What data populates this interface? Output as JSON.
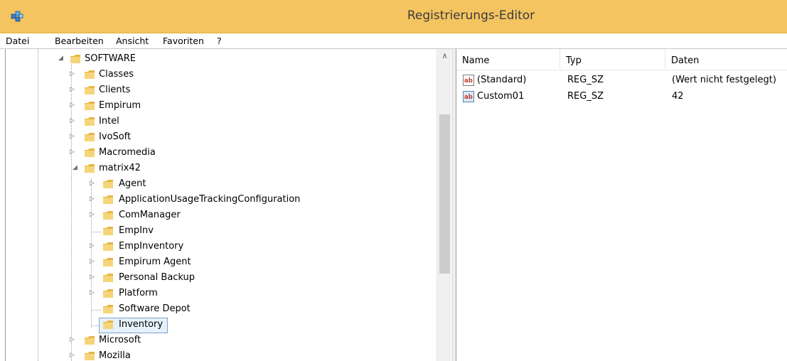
{
  "window": {
    "title": "Registrierungs-Editor",
    "icon": "registry-editor-icon"
  },
  "menu": [
    "Datei",
    "Bearbeiten",
    "Ansicht",
    "Favoriten",
    "?"
  ],
  "tree": {
    "root": {
      "label": "SOFTWARE",
      "expanded": true
    },
    "level1_before": [
      {
        "label": "Classes"
      },
      {
        "label": "Clients"
      },
      {
        "label": "Empirum"
      },
      {
        "label": "Intel"
      },
      {
        "label": "IvoSoft"
      },
      {
        "label": "Macromedia"
      }
    ],
    "expanded_node": {
      "label": "matrix42",
      "expanded": true
    },
    "children": [
      {
        "label": "Agent",
        "has_children": true
      },
      {
        "label": "ApplicationUsageTrackingConfiguration",
        "has_children": true
      },
      {
        "label": "ComManager",
        "has_children": true
      },
      {
        "label": "EmpInv",
        "has_children": false
      },
      {
        "label": "EmpInventory",
        "has_children": true
      },
      {
        "label": "Empirum Agent",
        "has_children": true
      },
      {
        "label": "Personal Backup",
        "has_children": true
      },
      {
        "label": "Platform",
        "has_children": true
      },
      {
        "label": "Software Depot",
        "has_children": false
      },
      {
        "label": "Inventory",
        "has_children": false,
        "selected": true
      }
    ],
    "level1_after": [
      {
        "label": "Microsoft"
      },
      {
        "label": "Mozilla"
      }
    ]
  },
  "values": {
    "columns": [
      "Name",
      "Typ",
      "Daten"
    ],
    "rows": [
      {
        "icon": "string-value-icon",
        "name": "(Standard)",
        "type": "REG_SZ",
        "data": "(Wert nicht festgelegt)"
      },
      {
        "icon": "string-value-icon",
        "name": "Custom01",
        "type": "REG_SZ",
        "data": "42"
      }
    ]
  },
  "colors": {
    "titlebar": "#f4c460",
    "selection": "#e5f1fb",
    "selection_border": "#7da2ce"
  }
}
